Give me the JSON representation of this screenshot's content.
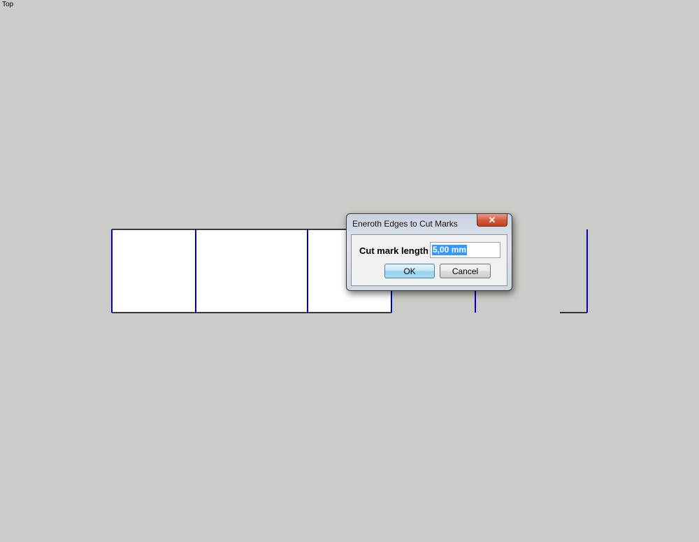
{
  "view": {
    "label": "Top"
  },
  "dialog": {
    "title": "Eneroth Edges to Cut Marks",
    "close_symbol": "✕",
    "field_label": "Cut mark length",
    "field_value": "5,00 mm",
    "ok_label": "OK",
    "cancel_label": "Cancel"
  },
  "colors": {
    "background": "#cbccc7",
    "edge_black": "#000000",
    "edge_blue": "#0000cc",
    "face_white": "#ffffff",
    "selection": "#3399ff"
  }
}
